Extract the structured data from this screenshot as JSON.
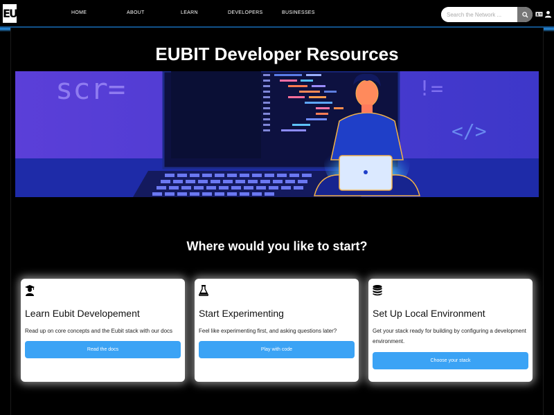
{
  "header": {
    "logo_text": "EU",
    "nav": [
      "HOME",
      "ABOUT",
      "LEARN",
      "DEVELOPERS",
      "BUSINESSES"
    ],
    "search_placeholder": "Search the Network ...",
    "icons": [
      "search-icon",
      "id-card-icon",
      "user-icon"
    ]
  },
  "main": {
    "title": "EUBIT Developer Resources",
    "hero_code_text": "scr=",
    "hero_code_symbol": "!=",
    "hero_tag_symbol": "</>",
    "subtitle": "Where would you like to start?"
  },
  "cards": [
    {
      "icon": "graduate-icon",
      "title": "Learn Eubit Developement",
      "description": "Read up on core concepts and the Eubit stack with our docs",
      "button": "Read the docs"
    },
    {
      "icon": "flask-icon",
      "title": "Start Experimenting",
      "description": "Feel like experimenting first, and asking questions later?",
      "button": "Play with code"
    },
    {
      "icon": "database-icon",
      "title": "Set Up Local Environment",
      "description": "Get your stack ready for building by configuring a development environment.",
      "button": "Choose your stack"
    }
  ],
  "colors": {
    "accent": "#3ba3f5",
    "hero_bg_left": "#5b3fd8",
    "hero_bg_right": "#3d37c9"
  }
}
